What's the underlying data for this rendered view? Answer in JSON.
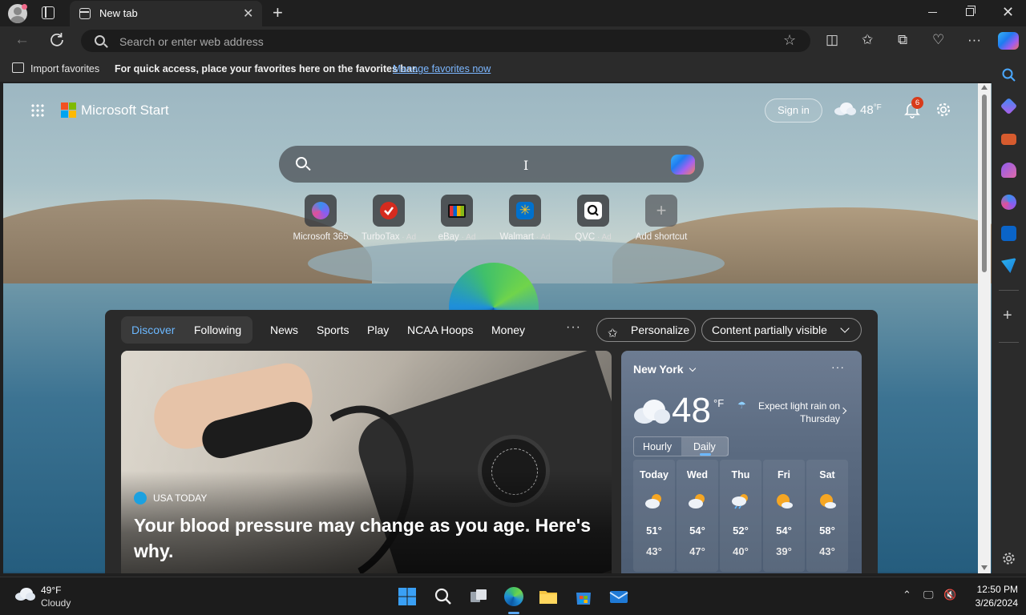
{
  "window": {
    "tab_title": "New tab"
  },
  "address_bar": {
    "placeholder": "Search or enter web address"
  },
  "favorites_bar": {
    "import_label": "Import favorites",
    "message": "For quick access, place your favorites here on the favorites bar.",
    "manage_link": "Manage favorites now"
  },
  "start": {
    "brand": "Microsoft Start",
    "sign_in": "Sign in",
    "weather_temp": "48",
    "weather_unit": "°F",
    "notifications_count": "6",
    "shortcuts": [
      {
        "label": "Microsoft 365",
        "ad": "",
        "icon": "microsoft-365-icon",
        "color": "#7b5cf0"
      },
      {
        "label": "TurboTax",
        "ad": " · Ad",
        "icon": "turbotax-icon",
        "color": "#d52b1e"
      },
      {
        "label": "eBay",
        "ad": " · Ad",
        "icon": "ebay-icon",
        "color": "#f5af02"
      },
      {
        "label": "Walmart",
        "ad": " · Ad",
        "icon": "walmart-icon",
        "color": "#0071ce"
      },
      {
        "label": "QVC",
        "ad": " · Ad",
        "icon": "qvc-icon",
        "color": "#ffffff"
      },
      {
        "label": "Add shortcut",
        "ad": "",
        "icon": "plus-icon",
        "color": "#777777"
      }
    ]
  },
  "feed": {
    "tabs": [
      "Discover",
      "Following"
    ],
    "categories": [
      "News",
      "Sports",
      "Play",
      "NCAA Hoops",
      "Money"
    ],
    "more": "···",
    "personalize": "Personalize",
    "content_visibility": "Content partially visible",
    "hero": {
      "source": "USA TODAY",
      "headline": "Your blood pressure may change as you age. Here's why."
    },
    "weather": {
      "city": "New York",
      "temp": "48",
      "unit": "°F",
      "alert": "Expect light rain on Thursday",
      "tabs": [
        "Hourly",
        "Daily"
      ],
      "days": [
        {
          "name": "Today",
          "hi": "51°",
          "lo": "43°",
          "icon": "partly-cloudy-icon"
        },
        {
          "name": "Wed",
          "hi": "54°",
          "lo": "47°",
          "icon": "partly-cloudy-icon"
        },
        {
          "name": "Thu",
          "hi": "52°",
          "lo": "40°",
          "icon": "rain-icon"
        },
        {
          "name": "Fri",
          "hi": "54°",
          "lo": "39°",
          "icon": "mostly-sunny-icon"
        },
        {
          "name": "Sat",
          "hi": "58°",
          "lo": "43°",
          "icon": "mostly-sunny-icon"
        }
      ]
    }
  },
  "taskbar": {
    "weather_temp": "49°F",
    "weather_condition": "Cloudy",
    "time": "12:50 PM",
    "date": "3/26/2024"
  },
  "colors": {
    "accent": "#6cb8ff",
    "link": "#7cb7ff",
    "badge": "#d83b1a"
  }
}
